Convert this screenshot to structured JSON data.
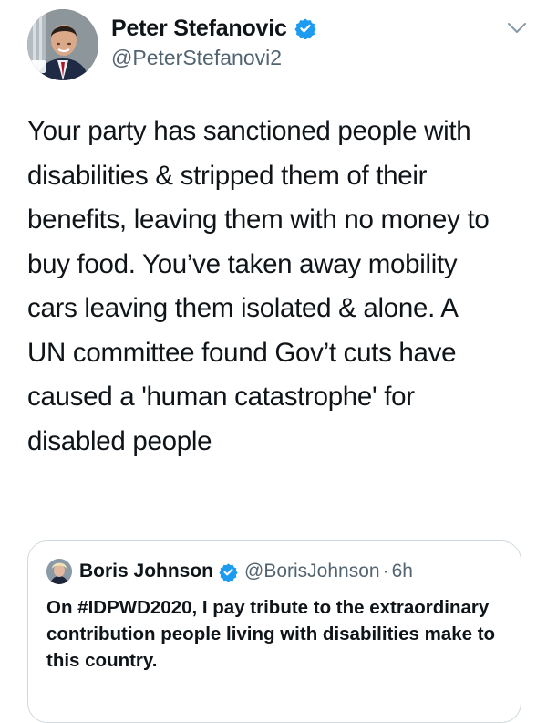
{
  "tweet": {
    "author": {
      "name": "Peter Stefanovic",
      "handle": "@PeterStefanovi2",
      "avatar_badge": "cwu",
      "verified": true
    },
    "menu_icon": "chevron-down-icon",
    "text": "Your party has sanctioned people with disabilities & stripped them of their benefits, leaving them with no money to buy food. You’ve taken away mobility cars leaving them isolated & alone. A UN committee found Gov’t cuts have caused a 'human catastrophe' for disabled people"
  },
  "quoted_tweet": {
    "author": {
      "name": "Boris Johnson",
      "handle": "@BorisJohnson",
      "separator": "·",
      "time": "6h",
      "verified": true
    },
    "text": "On #IDPWD2020, I pay tribute to the extraordinary contribution people living with disabilities make to this country."
  },
  "colors": {
    "verified_blue": "#1d9bf0",
    "text_primary": "#0f1419",
    "text_secondary": "#536471",
    "border": "#cfd9de"
  }
}
